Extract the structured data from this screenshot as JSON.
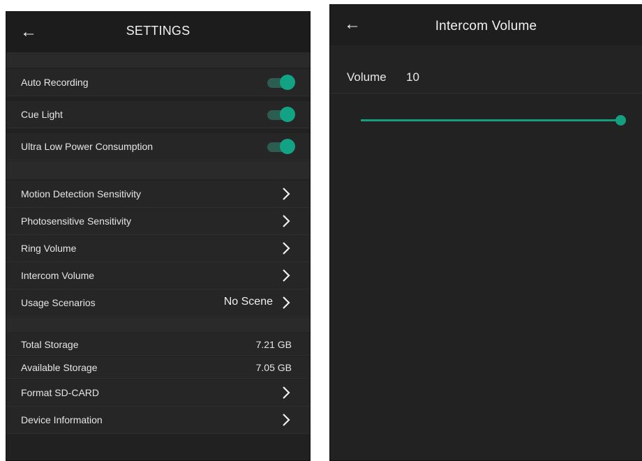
{
  "settings": {
    "title": "SETTINGS",
    "toggles": [
      {
        "label": "Auto Recording",
        "on": true
      },
      {
        "label": "Cue Light",
        "on": true
      },
      {
        "label": "Ultra Low Power Consumption",
        "on": true
      }
    ],
    "menu": [
      {
        "label": "Motion Detection Sensitivity"
      },
      {
        "label": "Photosensitive Sensitivity"
      },
      {
        "label": "Ring Volume"
      },
      {
        "label": "Intercom Volume"
      },
      {
        "label": "Usage Scenarios",
        "value": "No Scene"
      }
    ],
    "storage": [
      {
        "label": "Total Storage",
        "value": "7.21 GB"
      },
      {
        "label": "Available Storage",
        "value": "7.05 GB"
      }
    ],
    "actions": [
      {
        "label": "Format SD-CARD"
      },
      {
        "label": "Device Information"
      }
    ]
  },
  "intercom": {
    "title": "Intercom Volume",
    "volume_label": "Volume",
    "volume_value": "10",
    "slider_level": 1.0
  },
  "colors": {
    "accent": "#14a080",
    "panel_bg": "#212121"
  },
  "icons": {
    "back": "arrow-left-icon",
    "chevron": "chevron-right-icon"
  }
}
